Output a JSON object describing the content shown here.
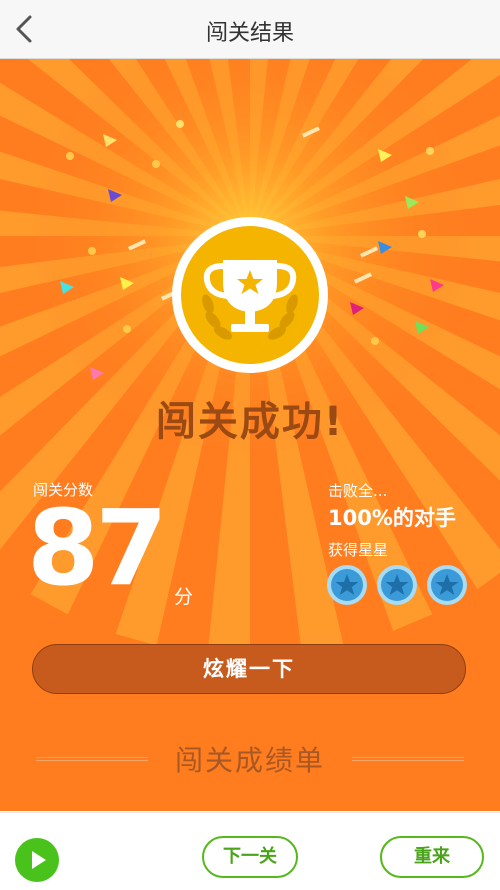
{
  "nav": {
    "title": "闯关结果",
    "back_icon": "chevron-left-icon"
  },
  "result": {
    "headline": "闯关成功!",
    "score_label": "闯关分数",
    "score": "87",
    "score_unit": "分",
    "defeat_label": "击败全...",
    "defeat_value": "100%的对手",
    "stars_label": "获得星星",
    "stars_earned": 3,
    "stars_total": 3,
    "share_button": "炫耀一下",
    "report_title": "闯关成绩单"
  },
  "bottom": {
    "play_icon": "play-icon",
    "next_button": "下一关",
    "retry_button": "重来"
  },
  "colors": {
    "panel": "#ff7d1f",
    "trophy_gold": "#f5b400",
    "star_blue": "#3a9bd8",
    "accent_green": "#4ac21c"
  }
}
